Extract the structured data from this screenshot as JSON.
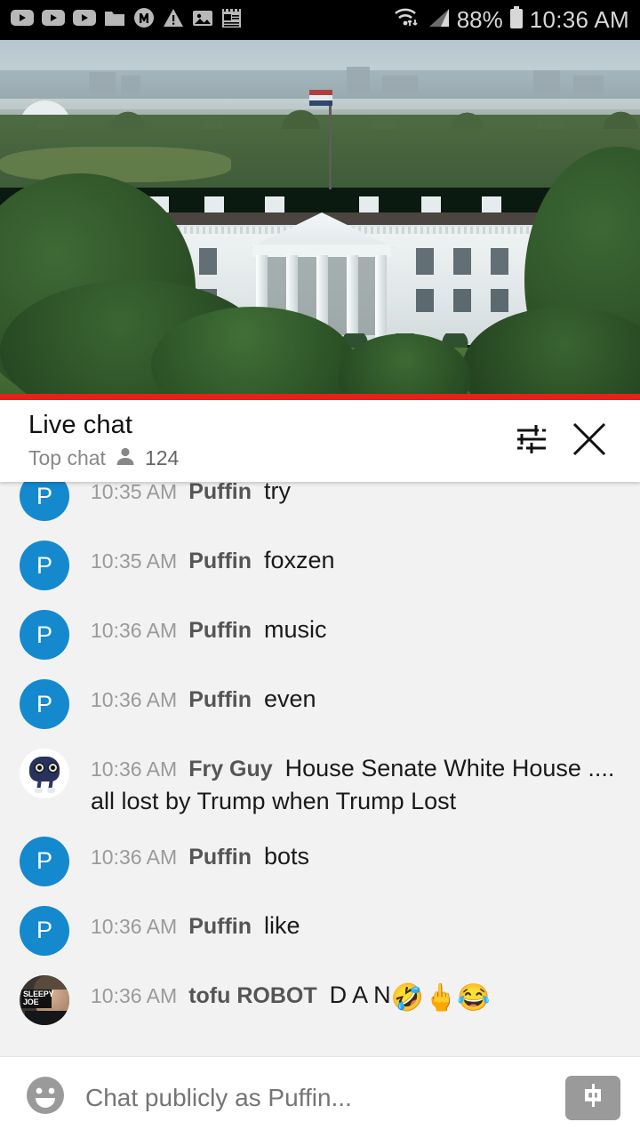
{
  "statusbar": {
    "icons": [
      "youtube-icon",
      "youtube-icon",
      "youtube-icon",
      "folder-icon",
      "m-circle-icon",
      "warning-triangle-icon",
      "image-icon",
      "notepad-icon"
    ],
    "wifi_icon": "wifi-icon",
    "signal_icon": "signal-icon",
    "battery_percent": "88%",
    "battery_icon": "battery-icon",
    "time": "10:36 AM"
  },
  "video": {
    "description": "White House north facade live stream",
    "progress_color": "#e62117",
    "progress_percent": 100
  },
  "chat_header": {
    "title": "Live chat",
    "mode": "Top chat",
    "viewer_count": "124",
    "person_icon": "person-icon",
    "filter_icon": "tune-filter-icon",
    "close_icon": "close-icon"
  },
  "messages": [
    {
      "id": 0,
      "clipped": true,
      "avatar_type": "p",
      "avatar_letter": "P",
      "time": "10:35 AM",
      "author": "Puffin",
      "text": "try",
      "emojis": []
    },
    {
      "id": 1,
      "clipped": false,
      "avatar_type": "p",
      "avatar_letter": "P",
      "time": "10:35 AM",
      "author": "Puffin",
      "text": "foxzen",
      "emojis": []
    },
    {
      "id": 2,
      "clipped": false,
      "avatar_type": "p",
      "avatar_letter": "P",
      "time": "10:36 AM",
      "author": "Puffin",
      "text": "music",
      "emojis": []
    },
    {
      "id": 3,
      "clipped": false,
      "avatar_type": "p",
      "avatar_letter": "P",
      "time": "10:36 AM",
      "author": "Puffin",
      "text": "even",
      "emojis": []
    },
    {
      "id": 4,
      "clipped": false,
      "avatar_type": "fryguy",
      "avatar_letter": "",
      "time": "10:36 AM",
      "author": "Fry Guy",
      "text": "House Senate White House .... all lost by Trump when Trump Lost",
      "emojis": []
    },
    {
      "id": 5,
      "clipped": false,
      "avatar_type": "p",
      "avatar_letter": "P",
      "time": "10:36 AM",
      "author": "Puffin",
      "text": "bots",
      "emojis": []
    },
    {
      "id": 6,
      "clipped": false,
      "avatar_type": "p",
      "avatar_letter": "P",
      "time": "10:36 AM",
      "author": "Puffin",
      "text": "like",
      "emojis": []
    },
    {
      "id": 7,
      "clipped": false,
      "avatar_type": "tofu",
      "avatar_letter": "",
      "time": "10:36 AM",
      "author": "tofu ROBOT",
      "text": "D A N",
      "emojis": [
        "🤣",
        "🖕",
        "😂"
      ]
    }
  ],
  "avatars": {
    "fryguy_label": "fry-guy-avatar",
    "tofu_label_line1": "SLEEPY",
    "tofu_label_line2": "JOE"
  },
  "input_bar": {
    "emoji_icon": "emoji-smiley-icon",
    "placeholder": "Chat publicly as Puffin...",
    "value": "",
    "superchat_icon": "dollar-superchat-icon"
  },
  "colors": {
    "accent_blue": "#1589ce",
    "progress_red": "#e62117",
    "chat_bg": "#f2f2f2",
    "status_bg": "#000000"
  }
}
